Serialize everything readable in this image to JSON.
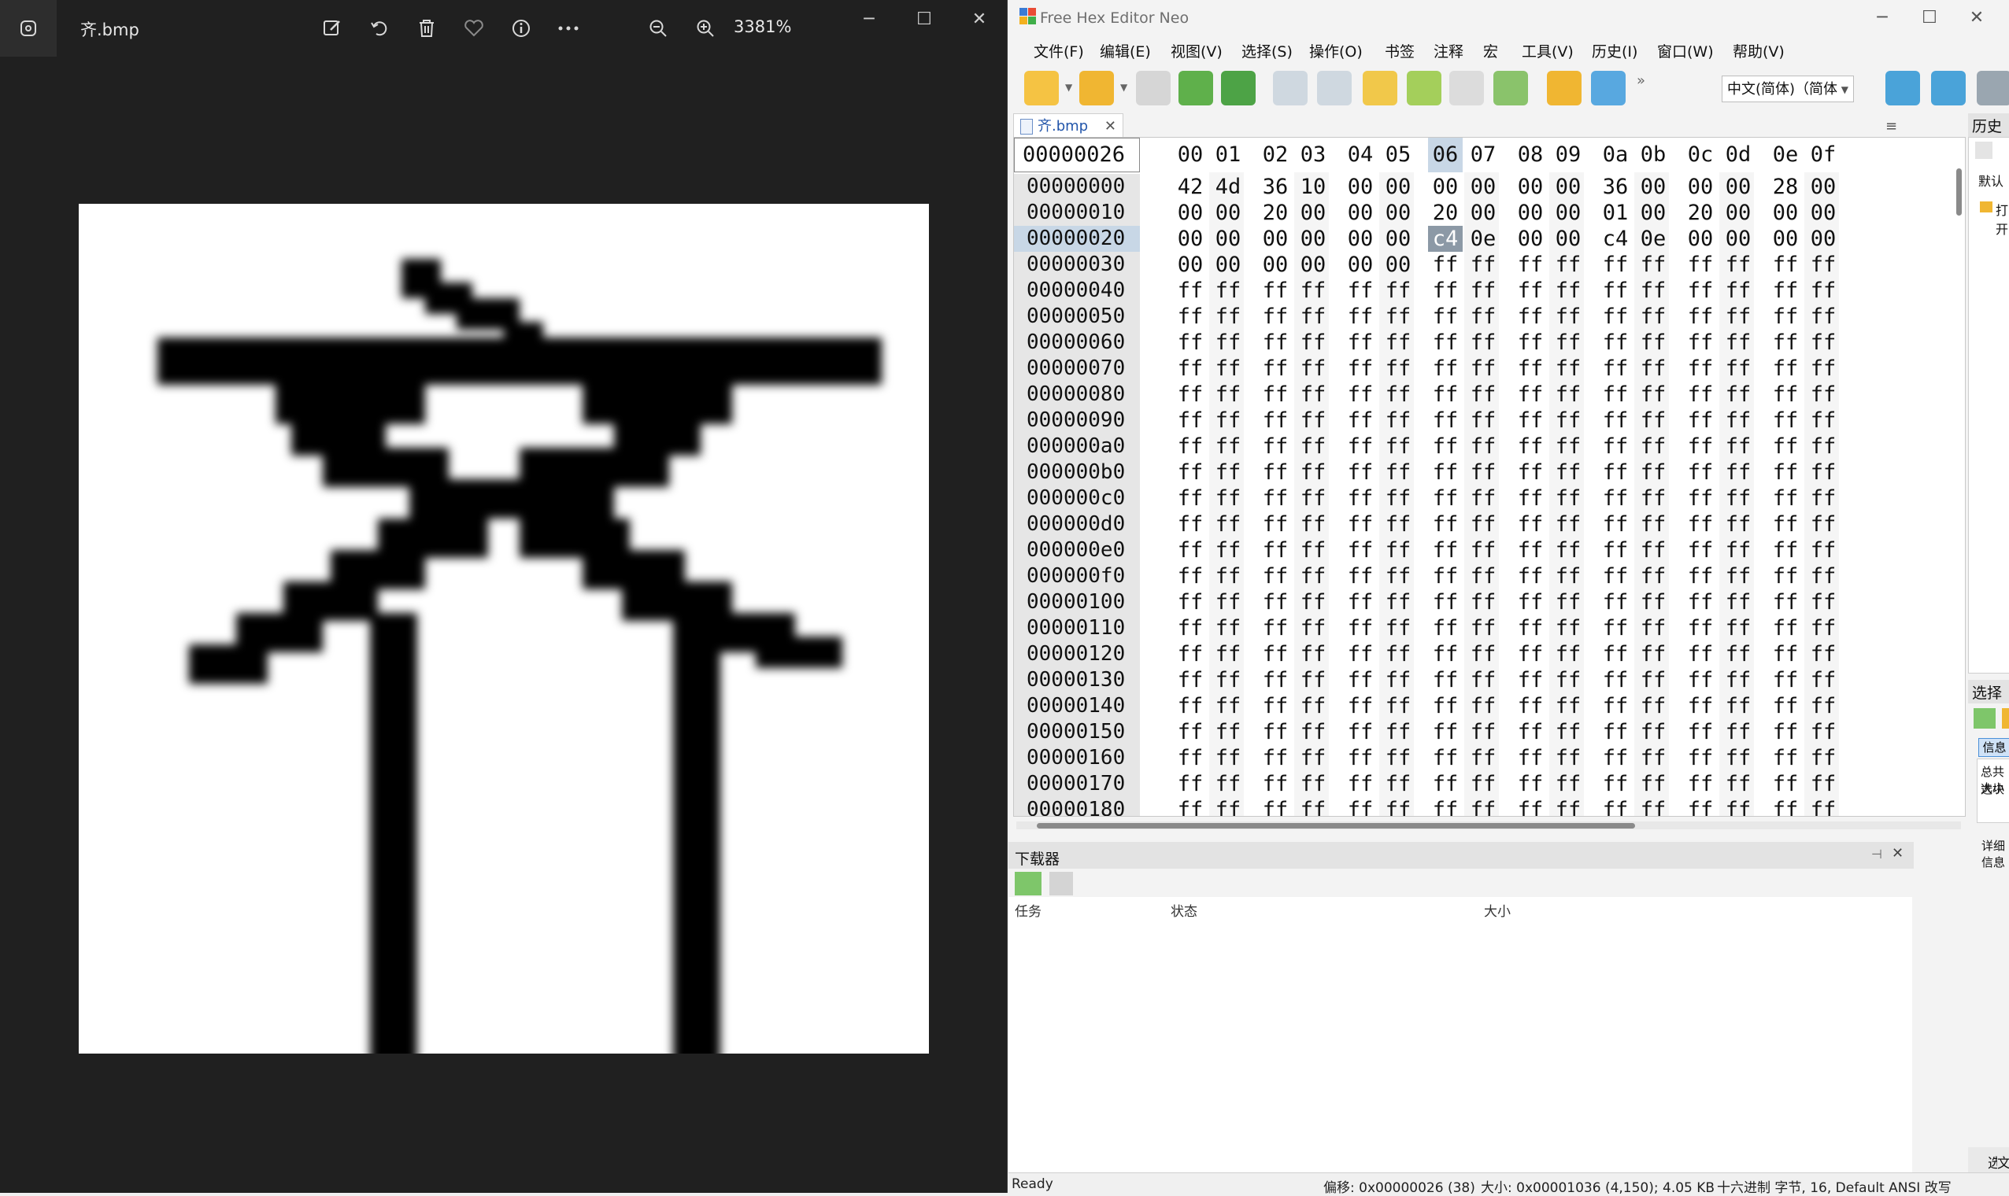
{
  "viewer": {
    "file_name": "齐.bmp",
    "zoom": "3381%",
    "toolbar_icons": [
      "edit-image-icon",
      "rotate-icon",
      "delete-icon",
      "favorite-icon",
      "info-icon",
      "more-icon"
    ],
    "zoom_icons": [
      "zoom-out-icon",
      "zoom-in-icon"
    ],
    "window_controls": [
      "minimize-icon",
      "maximize-icon",
      "close-icon"
    ]
  },
  "hex": {
    "app_title": "Free Hex Editor Neo",
    "menus": [
      "文件(F)",
      "编辑(E)",
      "视图(V)",
      "选择(S)",
      "操作(O)",
      "书签",
      "注释",
      "宏",
      "工具(V)",
      "历史(I)",
      "窗口(W)",
      "帮助(V)"
    ],
    "encoding": "中文(简体)（简体",
    "tab_label": "齐.bmp",
    "current_offset": "00000026",
    "column_headers": [
      "00",
      "01",
      "02",
      "03",
      "04",
      "05",
      "06",
      "07",
      "08",
      "09",
      "0a",
      "0b",
      "0c",
      "0d",
      "0e",
      "0f"
    ],
    "selected_column": "06",
    "rows": [
      {
        "offset": "00000000",
        "bytes": [
          "42",
          "4d",
          "36",
          "10",
          "00",
          "00",
          "00",
          "00",
          "00",
          "00",
          "36",
          "00",
          "00",
          "00",
          "28",
          "00"
        ]
      },
      {
        "offset": "00000010",
        "bytes": [
          "00",
          "00",
          "20",
          "00",
          "00",
          "00",
          "20",
          "00",
          "00",
          "00",
          "01",
          "00",
          "20",
          "00",
          "00",
          "00"
        ]
      },
      {
        "offset": "00000020",
        "bytes": [
          "00",
          "00",
          "00",
          "00",
          "00",
          "00",
          "c4",
          "0e",
          "00",
          "00",
          "c4",
          "0e",
          "00",
          "00",
          "00",
          "00"
        ]
      },
      {
        "offset": "00000030",
        "bytes": [
          "00",
          "00",
          "00",
          "00",
          "00",
          "00",
          "ff",
          "ff",
          "ff",
          "ff",
          "ff",
          "ff",
          "ff",
          "ff",
          "ff",
          "ff"
        ]
      },
      {
        "offset": "00000040",
        "bytes": [
          "ff",
          "ff",
          "ff",
          "ff",
          "ff",
          "ff",
          "ff",
          "ff",
          "ff",
          "ff",
          "ff",
          "ff",
          "ff",
          "ff",
          "ff",
          "ff"
        ]
      },
      {
        "offset": "00000050",
        "bytes": [
          "ff",
          "ff",
          "ff",
          "ff",
          "ff",
          "ff",
          "ff",
          "ff",
          "ff",
          "ff",
          "ff",
          "ff",
          "ff",
          "ff",
          "ff",
          "ff"
        ]
      },
      {
        "offset": "00000060",
        "bytes": [
          "ff",
          "ff",
          "ff",
          "ff",
          "ff",
          "ff",
          "ff",
          "ff",
          "ff",
          "ff",
          "ff",
          "ff",
          "ff",
          "ff",
          "ff",
          "ff"
        ]
      },
      {
        "offset": "00000070",
        "bytes": [
          "ff",
          "ff",
          "ff",
          "ff",
          "ff",
          "ff",
          "ff",
          "ff",
          "ff",
          "ff",
          "ff",
          "ff",
          "ff",
          "ff",
          "ff",
          "ff"
        ]
      },
      {
        "offset": "00000080",
        "bytes": [
          "ff",
          "ff",
          "ff",
          "ff",
          "ff",
          "ff",
          "ff",
          "ff",
          "ff",
          "ff",
          "ff",
          "ff",
          "ff",
          "ff",
          "ff",
          "ff"
        ]
      },
      {
        "offset": "00000090",
        "bytes": [
          "ff",
          "ff",
          "ff",
          "ff",
          "ff",
          "ff",
          "ff",
          "ff",
          "ff",
          "ff",
          "ff",
          "ff",
          "ff",
          "ff",
          "ff",
          "ff"
        ]
      },
      {
        "offset": "000000a0",
        "bytes": [
          "ff",
          "ff",
          "ff",
          "ff",
          "ff",
          "ff",
          "ff",
          "ff",
          "ff",
          "ff",
          "ff",
          "ff",
          "ff",
          "ff",
          "ff",
          "ff"
        ]
      },
      {
        "offset": "000000b0",
        "bytes": [
          "ff",
          "ff",
          "ff",
          "ff",
          "ff",
          "ff",
          "ff",
          "ff",
          "ff",
          "ff",
          "ff",
          "ff",
          "ff",
          "ff",
          "ff",
          "ff"
        ]
      },
      {
        "offset": "000000c0",
        "bytes": [
          "ff",
          "ff",
          "ff",
          "ff",
          "ff",
          "ff",
          "ff",
          "ff",
          "ff",
          "ff",
          "ff",
          "ff",
          "ff",
          "ff",
          "ff",
          "ff"
        ]
      },
      {
        "offset": "000000d0",
        "bytes": [
          "ff",
          "ff",
          "ff",
          "ff",
          "ff",
          "ff",
          "ff",
          "ff",
          "ff",
          "ff",
          "ff",
          "ff",
          "ff",
          "ff",
          "ff",
          "ff"
        ]
      },
      {
        "offset": "000000e0",
        "bytes": [
          "ff",
          "ff",
          "ff",
          "ff",
          "ff",
          "ff",
          "ff",
          "ff",
          "ff",
          "ff",
          "ff",
          "ff",
          "ff",
          "ff",
          "ff",
          "ff"
        ]
      },
      {
        "offset": "000000f0",
        "bytes": [
          "ff",
          "ff",
          "ff",
          "ff",
          "ff",
          "ff",
          "ff",
          "ff",
          "ff",
          "ff",
          "ff",
          "ff",
          "ff",
          "ff",
          "ff",
          "ff"
        ]
      },
      {
        "offset": "00000100",
        "bytes": [
          "ff",
          "ff",
          "ff",
          "ff",
          "ff",
          "ff",
          "ff",
          "ff",
          "ff",
          "ff",
          "ff",
          "ff",
          "ff",
          "ff",
          "ff",
          "ff"
        ]
      },
      {
        "offset": "00000110",
        "bytes": [
          "ff",
          "ff",
          "ff",
          "ff",
          "ff",
          "ff",
          "ff",
          "ff",
          "ff",
          "ff",
          "ff",
          "ff",
          "ff",
          "ff",
          "ff",
          "ff"
        ]
      },
      {
        "offset": "00000120",
        "bytes": [
          "ff",
          "ff",
          "ff",
          "ff",
          "ff",
          "ff",
          "ff",
          "ff",
          "ff",
          "ff",
          "ff",
          "ff",
          "ff",
          "ff",
          "ff",
          "ff"
        ]
      },
      {
        "offset": "00000130",
        "bytes": [
          "ff",
          "ff",
          "ff",
          "ff",
          "ff",
          "ff",
          "ff",
          "ff",
          "ff",
          "ff",
          "ff",
          "ff",
          "ff",
          "ff",
          "ff",
          "ff"
        ]
      },
      {
        "offset": "00000140",
        "bytes": [
          "ff",
          "ff",
          "ff",
          "ff",
          "ff",
          "ff",
          "ff",
          "ff",
          "ff",
          "ff",
          "ff",
          "ff",
          "ff",
          "ff",
          "ff",
          "ff"
        ]
      },
      {
        "offset": "00000150",
        "bytes": [
          "ff",
          "ff",
          "ff",
          "ff",
          "ff",
          "ff",
          "ff",
          "ff",
          "ff",
          "ff",
          "ff",
          "ff",
          "ff",
          "ff",
          "ff",
          "ff"
        ]
      },
      {
        "offset": "00000160",
        "bytes": [
          "ff",
          "ff",
          "ff",
          "ff",
          "ff",
          "ff",
          "ff",
          "ff",
          "ff",
          "ff",
          "ff",
          "ff",
          "ff",
          "ff",
          "ff",
          "ff"
        ]
      },
      {
        "offset": "00000170",
        "bytes": [
          "ff",
          "ff",
          "ff",
          "ff",
          "ff",
          "ff",
          "ff",
          "ff",
          "ff",
          "ff",
          "ff",
          "ff",
          "ff",
          "ff",
          "ff",
          "ff"
        ]
      },
      {
        "offset": "00000180",
        "bytes": [
          "ff",
          "ff",
          "ff",
          "ff",
          "ff",
          "ff",
          "ff",
          "ff",
          "ff",
          "ff",
          "ff",
          "ff",
          "ff",
          "ff",
          "ff",
          "ff"
        ]
      }
    ],
    "history_panel": {
      "title": "历史",
      "items": [
        "默认",
        "打开"
      ]
    },
    "selection_panel": {
      "title": "选择",
      "info_tab": "信息",
      "lines": [
        "总共大小",
        "选块"
      ],
      "details": "详细信息"
    },
    "downloader": {
      "title": "下载器",
      "columns": [
        "任务",
        "状态",
        "大小"
      ]
    },
    "bottom_tabs": [
      "选扌",
      "文"
    ],
    "status": {
      "ready": "Ready",
      "position": "偏移: 0x00000026 (38)",
      "size": "大小: 0x00001036 (4,150); 4.05 KB",
      "mode": "十六进制 字节, 16, Default ANSI 改写"
    }
  }
}
